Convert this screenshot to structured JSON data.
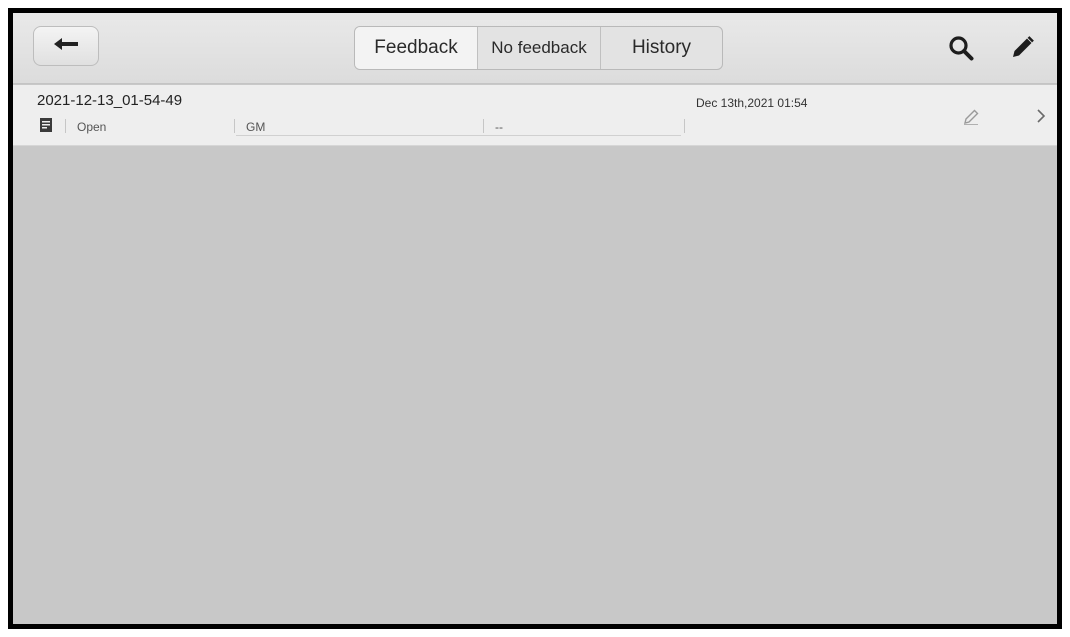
{
  "toolbar": {
    "back_icon": "back-arrow-icon",
    "tabs": [
      {
        "label": "Feedback",
        "active": true
      },
      {
        "label": "No feedback",
        "active": false
      },
      {
        "label": "History",
        "active": false
      }
    ],
    "search_icon": "search-icon",
    "edit_icon": "pencil-icon"
  },
  "records": [
    {
      "title": "2021-12-13_01-54-49",
      "date": "Dec 13th,2021 01:54",
      "status": "Open",
      "make": "GM",
      "detail": "--",
      "icon": "document-icon"
    }
  ],
  "colors": {
    "background": "#c8c8c8",
    "toolbar": "#e4e4e4",
    "row": "#eeeeee",
    "border": "#000000"
  }
}
